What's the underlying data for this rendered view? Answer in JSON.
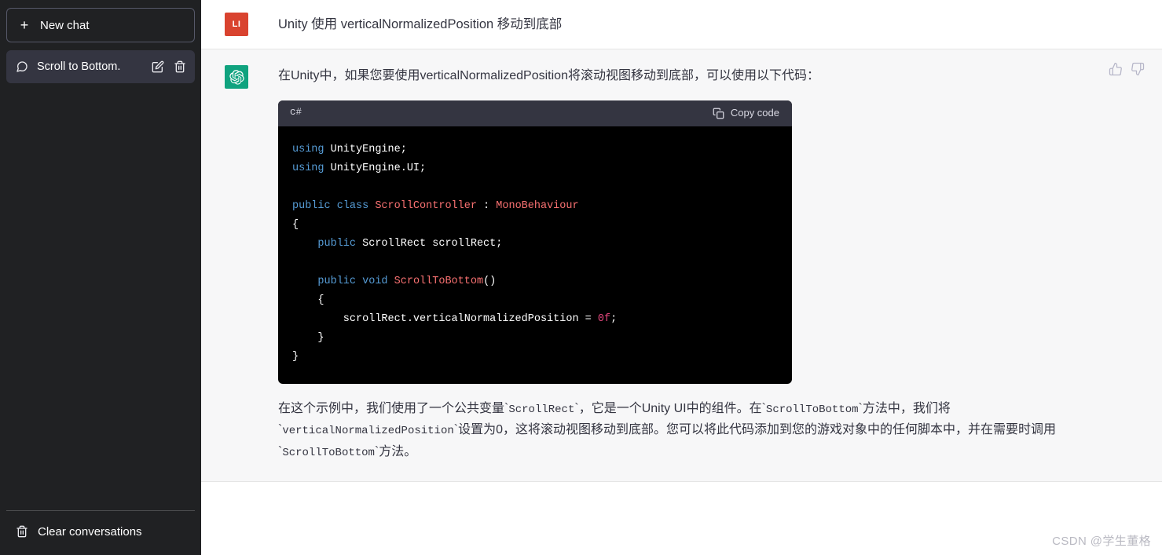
{
  "sidebar": {
    "new_chat": {
      "label": "New chat",
      "icon": "plus-icon"
    },
    "conversations": [
      {
        "label": "Scroll to Bottom.",
        "icon": "chat-bubble-icon",
        "edit_icon": "pencil-icon",
        "delete_icon": "trash-icon",
        "active": true
      }
    ],
    "bottom": {
      "clear_conversations": {
        "label": "Clear conversations",
        "icon": "trash-icon"
      }
    },
    "colors": {
      "bg": "#202123",
      "active_item": "#343541",
      "border": "#565869"
    }
  },
  "conversation": {
    "user_message": {
      "avatar_initials": "LI",
      "avatar_color": "#d9432f",
      "text": "Unity 使用 verticalNormalizedPosition 移动到底部"
    },
    "assistant_message": {
      "avatar_color": "#10a37f",
      "avatar_icon": "openai-logo-icon",
      "paragraph_1": "在Unity中，如果您要使用verticalNormalizedPosition将滚动视图移动到底部，可以使用以下代码：",
      "feedback": {
        "thumbs_up_icon": "thumbs-up-icon",
        "thumbs_down_icon": "thumbs-down-icon"
      },
      "code_block": {
        "language": "c#",
        "copy_label": "Copy code",
        "copy_icon": "clipboard-icon",
        "lines": [
          [
            {
              "t": "using ",
              "c": "kw"
            },
            {
              "t": "UnityEngine",
              "c": "pl"
            },
            {
              "t": ";",
              "c": "pl"
            }
          ],
          [
            {
              "t": "using ",
              "c": "kw"
            },
            {
              "t": "UnityEngine.UI",
              "c": "pl"
            },
            {
              "t": ";",
              "c": "pl"
            }
          ],
          [],
          [
            {
              "t": "public ",
              "c": "kw"
            },
            {
              "t": "class ",
              "c": "kw"
            },
            {
              "t": "ScrollController",
              "c": "type"
            },
            {
              "t": " : ",
              "c": "pl"
            },
            {
              "t": "MonoBehaviour",
              "c": "type"
            }
          ],
          [
            {
              "t": "{",
              "c": "pl"
            }
          ],
          [
            {
              "t": "    ",
              "c": "pl"
            },
            {
              "t": "public ",
              "c": "kw"
            },
            {
              "t": "ScrollRect scrollRect;",
              "c": "pl"
            }
          ],
          [],
          [
            {
              "t": "    ",
              "c": "pl"
            },
            {
              "t": "public ",
              "c": "kw"
            },
            {
              "t": "void ",
              "c": "kw"
            },
            {
              "t": "ScrollToBottom",
              "c": "type"
            },
            {
              "t": "()",
              "c": "pl"
            }
          ],
          [
            {
              "t": "    {",
              "c": "pl"
            }
          ],
          [
            {
              "t": "        scrollRect.verticalNormalizedPosition = ",
              "c": "pl"
            },
            {
              "t": "0f",
              "c": "num"
            },
            {
              "t": ";",
              "c": "pl"
            }
          ],
          [
            {
              "t": "    }",
              "c": "pl"
            }
          ],
          [
            {
              "t": "}",
              "c": "pl"
            }
          ]
        ]
      },
      "paragraph_2_parts": [
        {
          "t": "在这个示例中，我们使用了一个公共变量`",
          "code": false
        },
        {
          "t": "ScrollRect",
          "code": true
        },
        {
          "t": "`，它是一个Unity UI中的组件。在`",
          "code": false
        },
        {
          "t": "ScrollToBottom",
          "code": true
        },
        {
          "t": "`方法中，我们将`",
          "code": false
        },
        {
          "t": "verticalNormalizedPosition",
          "code": true
        },
        {
          "t": "`设置为0，这将滚动视图移动到底部。您可以将此代码添加到您的游戏对象中的任何脚本中，并在需要时调用`",
          "code": false
        },
        {
          "t": "ScrollToBottom",
          "code": true
        },
        {
          "t": "`方法。",
          "code": false
        }
      ]
    }
  },
  "watermark": {
    "text": "CSDN @学生董格"
  }
}
